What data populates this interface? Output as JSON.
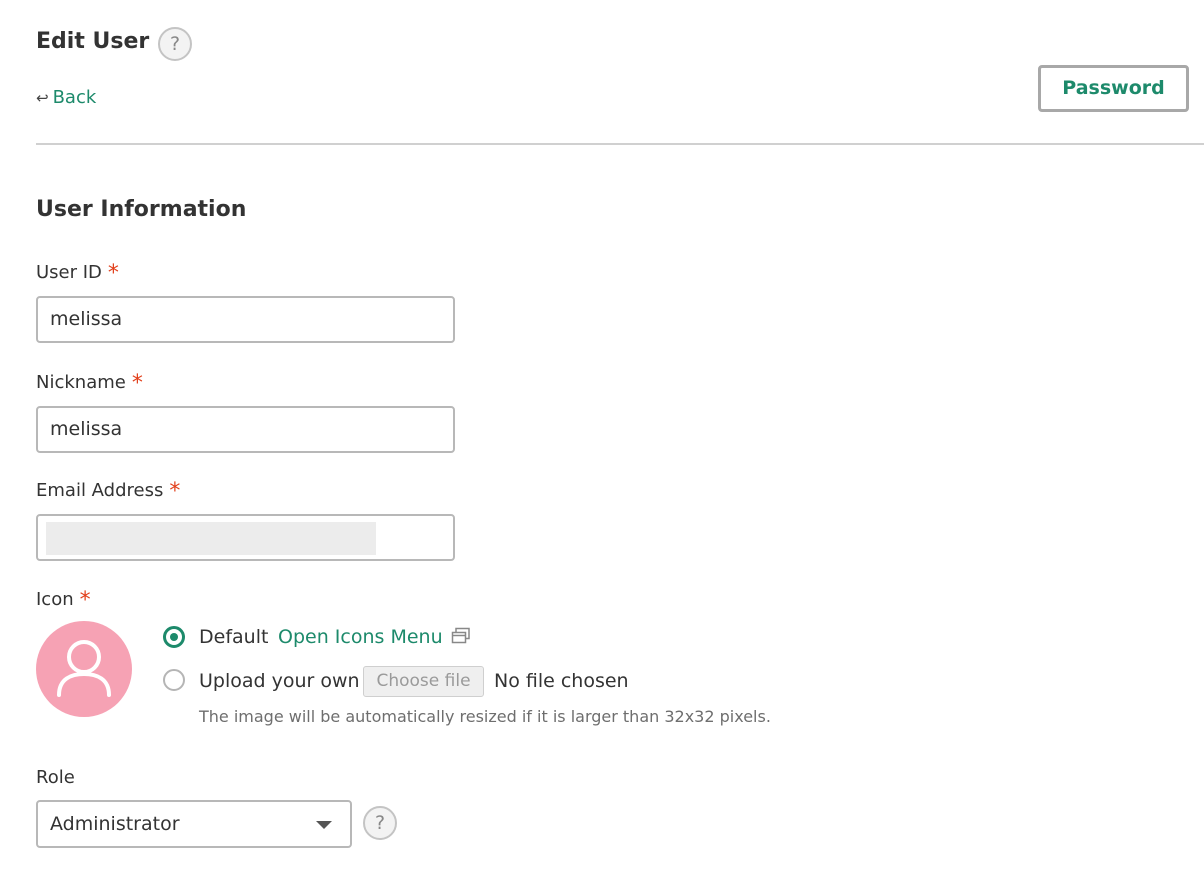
{
  "header": {
    "title": "Edit User",
    "help_glyph": "?",
    "back_label": "Back",
    "back_icon": "undo-arrow-icon",
    "password_label": "Password"
  },
  "section": {
    "title": "User Information"
  },
  "form": {
    "user_id": {
      "label": "User ID",
      "required_mark": "*",
      "value": "melissa"
    },
    "nickname": {
      "label": "Nickname",
      "required_mark": "*",
      "value": "melissa"
    },
    "email": {
      "label": "Email Address",
      "required_mark": "*",
      "value": ""
    },
    "icon": {
      "label": "Icon",
      "required_mark": "*",
      "avatar_icon": "user-silhouette-icon",
      "default_label": "Default",
      "default_selected": true,
      "open_icons_label": "Open Icons Menu",
      "upload_label": "Upload your own",
      "choose_file_label": "Choose file",
      "no_file_text": "No file chosen",
      "hint": "The image will be automatically resized if it is larger than 32x32 pixels."
    },
    "role": {
      "label": "Role",
      "selected": "Administrator",
      "help_glyph": "?"
    }
  },
  "colors": {
    "accent": "#1d8a6b",
    "required": "#e2401c",
    "avatar_bg": "#f6a2b4"
  }
}
